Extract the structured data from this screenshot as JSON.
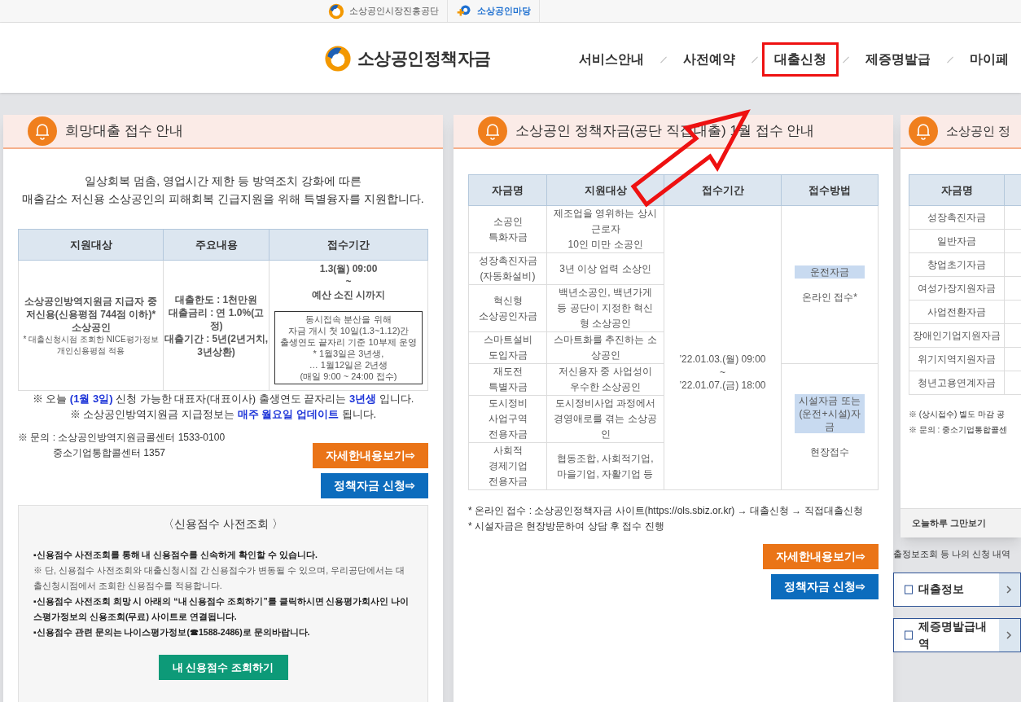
{
  "top_bar": {
    "links": [
      {
        "label": "소상공인시장진흥공단",
        "kind": "agency"
      },
      {
        "label": "소상공인마당",
        "kind": "portal"
      }
    ]
  },
  "header": {
    "logo": "소상공인정책자금",
    "nav": [
      {
        "label": "서비스안내",
        "marked": false
      },
      {
        "label": "사전예약",
        "marked": false
      },
      {
        "label": "대출신청",
        "marked": true
      },
      {
        "label": "제증명발급",
        "marked": false
      },
      {
        "label": "마이페",
        "marked": false
      }
    ]
  },
  "popup_1": {
    "title": "희망대출 접수 안내",
    "intro": [
      "일상회복 멈춤, 영업시간 제한 등 방역조치 강화에 따른",
      "매출감소 저신용 소상공인의 피해회복 긴급지원을 위해 특별융자를 지원합니다."
    ],
    "table": {
      "columns": [
        "지원대상",
        "주요내용",
        "접수기간"
      ],
      "target": {
        "main": "소상공인방역지원금 지급자 중\n저신용(신용평점 744점 이하)*\n소상공인",
        "footnote": "* 대출신청시점 조회한 NICE평가정보\n개인신용평점 적용"
      },
      "terms": [
        "대출한도 : 1천만원",
        "대출금리 : 연 1.0%(고정)",
        "대출기간 : 5년(2년거치, 3년상환)"
      ],
      "period": [
        "1.3(월) 09:00",
        "~",
        "예산 소진 시까지"
      ],
      "period_box": [
        "동시접속 분산을 위해",
        "자금 개시 첫 10일(1.3~1.12)간",
        "출생연도 끝자리 기준 10부제 운영",
        "* 1월3일은 3년생,",
        "… 1월12일은 2년생",
        "(매일 9:00 ~ 24:00 접수)"
      ]
    },
    "notes": [
      "※ 오늘 **(1월 3일)** 신청 가능한 대표자(대표이사) 출생연도 끝자리는 **3년생** 입니다.",
      "※ 소상공인방역지원금 지급정보는 **매주 월요일 업데이트** 됩니다."
    ],
    "contact": [
      "※ 문의 : 소상공인방역지원금콜센터 1533-0100",
      "중소기업통합콜센터 1357"
    ],
    "buttons": [
      {
        "label": "자세한내용보기⇨",
        "kind": "detail"
      },
      {
        "label": "정책자금 신청⇨",
        "kind": "apply"
      }
    ],
    "credit_check": {
      "title": "〈신용점수 사전조회 〉",
      "paragraphs": [
        {
          "text": "▪신용점수 사전조회를 통해 내 신용점수를 신속하게 확인할 수 있습니다.",
          "emphasis": true
        },
        {
          "text": "※ 단, 신용점수 사전조회와 대출신청시점 간 신용점수가 변동될 수 있으며, 우리공단에서는 대출신청시점에서 조회한 신용점수를 적용합니다.",
          "emphasis": false
        },
        {
          "text": "▪신용점수 사전조회 희망 시 아래의 “내 신용점수 조회하기”를 클릭하시면 신용평가회사인 나이스평가정보의 신용조회(무료) 사이트로 연결됩니다.",
          "emphasis": true
        },
        {
          "text": "▪신용점수 관련 문의는 나이스평가정보(☎1588-2486)로 문의바랍니다.",
          "emphasis": true
        }
      ],
      "button": "내 신용점수 조회하기"
    }
  },
  "popup_2": {
    "title": "소상공인 정책자금(공단 직접대출) 1월 접수 안내",
    "table": {
      "columns": [
        "자금명",
        "지원대상",
        "접수기간",
        "접수방법"
      ],
      "period": [
        "’22.01.03.(월) 09:00",
        "~",
        "’22.01.07.(금) 18:00"
      ],
      "methods": [
        {
          "tag": "운전자금",
          "label": "온라인 접수*",
          "funds": [
            {
              "name": "소공인\n특화자금",
              "target": "제조업을 영위하는 상시근로자\n10인 미만 소공인"
            },
            {
              "name": "성장촉진자금\n(자동화설비)",
              "target": "3년 이상 업력 소상인"
            },
            {
              "name": "혁신형\n소상공인자금",
              "target": "백년소공인, 백년가게 등 공단이 지정한 혁신형 소상공인"
            },
            {
              "name": "스마트설비\n도입자금",
              "target": "스마트화를 추진하는 소상공인"
            }
          ]
        },
        {
          "tag": "시설자금 또는\n(운전+시설)자금",
          "label": "현장접수",
          "funds": [
            {
              "name": "재도전\n특별자금",
              "target": "저신용자 중 사업성이 우수한 소상공인"
            },
            {
              "name": "도시정비\n사업구역\n전용자금",
              "target": "도시정비사업 과정에서\n경영애로를 겪는 소상공인"
            },
            {
              "name": "사회적\n경제기업\n전용자금",
              "target": "협동조합, 사회적기업,\n마을기업, 자활기업 등"
            }
          ]
        }
      ]
    },
    "notes": [
      "* 온라인 접수 : 소상공인정책자금 사이트(https://ols.sbiz.or.kr) → 대출신청 → 직접대출신청",
      "* 시설자금은 현장방문하여 상담 후 접수 진행"
    ],
    "buttons": [
      {
        "label": "자세한내용보기⇨",
        "kind": "detail"
      },
      {
        "label": "정책자금 신청⇨",
        "kind": "apply"
      }
    ]
  },
  "popup_3": {
    "title": "소상공인 정",
    "table": {
      "columns": [
        "자금명"
      ],
      "rows": [
        "성장촉진자금",
        "일반자금",
        "창업초기자금",
        "여성가장지원자금",
        "사업전환자금",
        "장애인기업지원자금",
        "위기지역지원자금",
        "청년고용연계자금"
      ]
    },
    "notes": [
      "※ (상시접수) 별도 마감 공",
      "※ 문의 : 중소기업통합콜센"
    ],
    "footer": "오늘하루 그만보기"
  },
  "background": {
    "caption": "출정보조회 등 나의 신청 내역",
    "links": [
      "대출정보",
      "제증명발급내역"
    ]
  }
}
